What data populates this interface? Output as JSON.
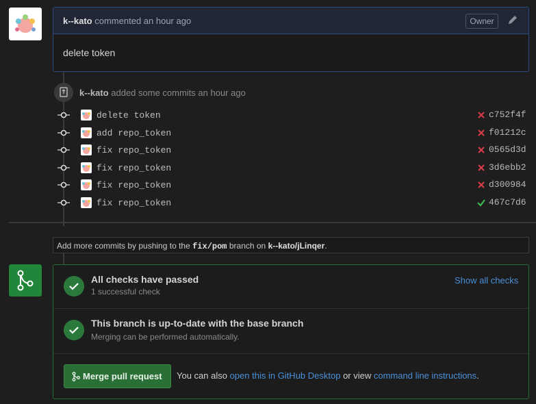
{
  "comment": {
    "author": "k--kato",
    "action": "commented an hour ago",
    "badge": "Owner",
    "body": "delete token"
  },
  "commits": {
    "author": "k--kato",
    "summary": "added some commits an hour ago",
    "items": [
      {
        "message": "delete token",
        "sha": "c752f4f",
        "status": "failed"
      },
      {
        "message": "add repo_token",
        "sha": "f01212c",
        "status": "failed"
      },
      {
        "message": "fix repo_token",
        "sha": "0565d3d",
        "status": "failed"
      },
      {
        "message": "fix repo_token",
        "sha": "3d6ebb2",
        "status": "failed"
      },
      {
        "message": "fix repo_token",
        "sha": "d300984",
        "status": "failed"
      },
      {
        "message": "fix repo_token",
        "sha": "467c7d6",
        "status": "success"
      }
    ]
  },
  "info": {
    "prefix": "Add more commits by pushing to the ",
    "branch": "fix/pom",
    "middle": " branch on ",
    "repo": "k--kato/jLinqer",
    "suffix": "."
  },
  "checks": {
    "title": "All checks have passed",
    "subtitle": "1 successful check",
    "show_all": "Show all checks"
  },
  "branch_status": {
    "title": "This branch is up-to-date with the base branch",
    "subtitle": "Merging can be performed automatically."
  },
  "merge": {
    "button": "Merge pull request",
    "text_prefix": "You can also ",
    "desktop_link": "open this in GitHub Desktop",
    "text_middle": " or view ",
    "cli_link": "command line instructions",
    "text_suffix": "."
  },
  "colors": {
    "accent_blue": "#4a90d9",
    "success_green": "#2b7a3b",
    "fail_red": "#d73a49"
  }
}
